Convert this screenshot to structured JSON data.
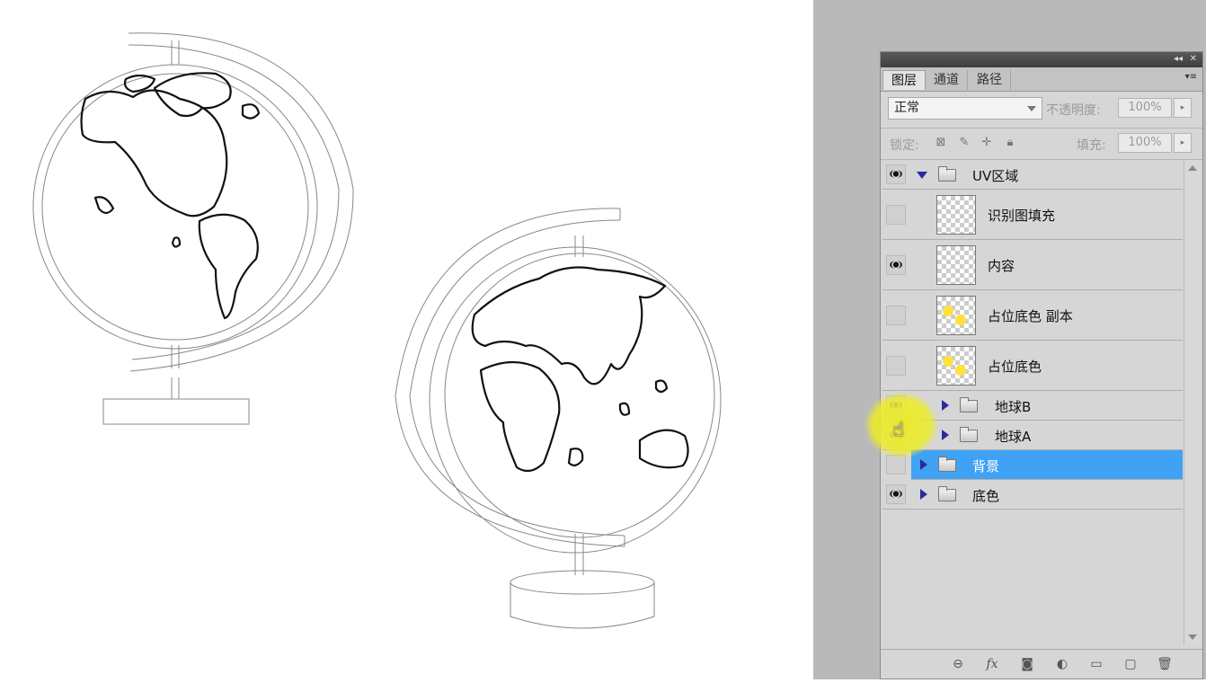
{
  "panel": {
    "tabs": [
      {
        "label": "图层",
        "active": true
      },
      {
        "label": "通道",
        "active": false
      },
      {
        "label": "路径",
        "active": false
      }
    ],
    "title_controls": {
      "collapse": "◂◂",
      "close": "✕"
    },
    "menu_icon": "▾≡",
    "blend_mode": "正常",
    "opacity_label": "不透明度:",
    "opacity_value": "100%",
    "lock_label": "锁定:",
    "fill_label": "填充:",
    "fill_value": "100%",
    "stepper_arrow": "▸"
  },
  "layers": [
    {
      "name": "UV区域",
      "kind": "group",
      "expanded": true,
      "visible": true
    },
    {
      "name": "识别图填充",
      "kind": "layer",
      "visible": false,
      "thumb": "transparent"
    },
    {
      "name": "内容",
      "kind": "layer",
      "visible": true,
      "thumb": "transparent"
    },
    {
      "name": "占位底色 副本",
      "kind": "layer",
      "visible": false,
      "thumb": "yellow-dots"
    },
    {
      "name": "占位底色",
      "kind": "layer",
      "visible": false,
      "thumb": "yellow-dots"
    },
    {
      "name": "地球B",
      "kind": "group",
      "expanded": false,
      "visible": true
    },
    {
      "name": "地球A",
      "kind": "group",
      "expanded": false,
      "visible": true
    },
    {
      "name": "背景",
      "kind": "group",
      "expanded": false,
      "visible": false,
      "selected": true
    },
    {
      "name": "底色",
      "kind": "group",
      "expanded": false,
      "visible": true
    }
  ],
  "icons": {
    "lock": [
      "lock-transparent-icon",
      "lock-paint-icon",
      "lock-move-icon",
      "lock-all-icon"
    ],
    "bottom": [
      "link-icon",
      "fx-icon",
      "mask-icon",
      "adjustment-icon",
      "new-group-icon",
      "new-layer-icon",
      "trash-icon"
    ]
  },
  "bottom_glyphs": [
    "⊖",
    "fx",
    "◙",
    "◐",
    "▭",
    "▢",
    "🗑"
  ],
  "colors": {
    "selection": "#3fa2f5",
    "workspace": "#b9b9b9",
    "panel": "#d6d6d6",
    "cursor_highlight": "#ecec28",
    "thumb_yellow": "#ffe23a"
  }
}
